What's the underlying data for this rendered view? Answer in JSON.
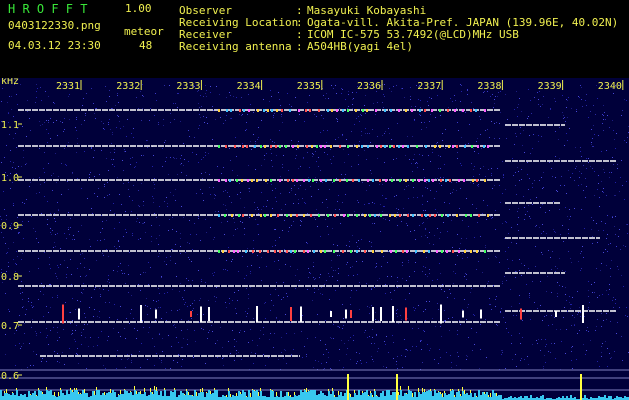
{
  "app": {
    "name": "H R O F F T",
    "version": "1.00",
    "filename": "0403122330.png",
    "datetime": "04.03.12 23:30",
    "meteor_label": "meteor",
    "meteor_count": "48"
  },
  "info": {
    "observer_label": "Observer",
    "observer_value": "Masayuki Kobayashi",
    "location_label": "Receiving Location",
    "location_value": "Ogata-vill. Akita-Pref. JAPAN (139.96E, 40.02N)",
    "receiver_label": "Receiver",
    "receiver_value": "ICOM IC-575 53.7492(@LCD)MHz USB",
    "antenna_label": "Receiving antenna",
    "antenna_value": "A504HB(yagi 4el)",
    "separator": ":"
  },
  "spectrogram": {
    "y_unit": "kHz",
    "y_ticks": [
      "1.1",
      "1.0",
      "0.9",
      "0.8",
      "0.7",
      "0.6"
    ],
    "x_ticks": [
      "2331",
      "2332",
      "2333",
      "2334",
      "2335",
      "2336",
      "2337",
      "2338",
      "2339",
      "2340"
    ],
    "colors": {
      "axis_text": "#f0f050",
      "background": "#00003a",
      "carrier_line": "#ffffff",
      "activity_bar": "#38c8f0",
      "meteor_spike": "#ffff40"
    }
  }
}
